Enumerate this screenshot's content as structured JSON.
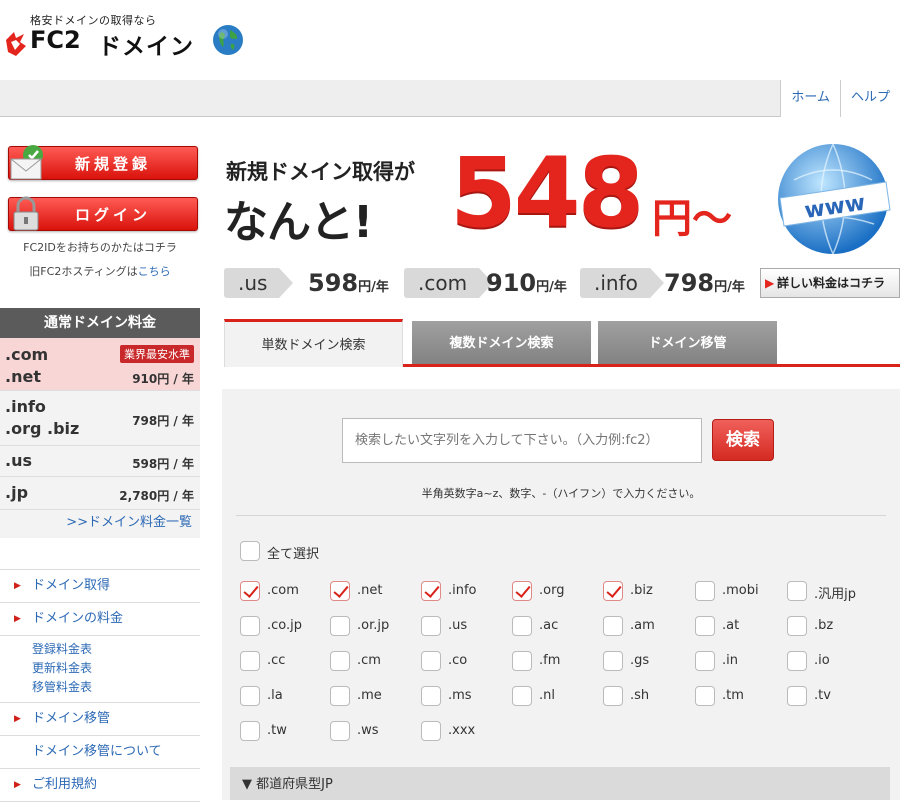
{
  "header": {
    "tagline": "格安ドメインの取得なら",
    "logo_fc2": "FC2",
    "logo_domain": "ドメイン",
    "nav": [
      "ホーム",
      "ヘルプ"
    ]
  },
  "sidebar": {
    "register_label": "新規登録",
    "login_label": "ログイン",
    "fc2id_note": "FC2IDをお持ちのかたはコチラ",
    "hosting_prefix": "旧FC2ホスティングは",
    "hosting_link": "こちら",
    "price_header": "通常ドメイン料金",
    "price_rows": [
      {
        "names": [
          ".com",
          ".net"
        ],
        "price": "910円 / 年",
        "badge": "業界最安水準"
      },
      {
        "names": [
          ".info",
          ".org .biz"
        ],
        "price": "798円 / 年"
      },
      {
        "names": [
          ".us"
        ],
        "price": "598円 / 年"
      },
      {
        "names": [
          ".jp"
        ],
        "price": "2,780円 / 年"
      }
    ],
    "price_list_link": ">>ドメイン料金一覧",
    "menu": {
      "acquire": "ドメイン取得",
      "pricing": "ドメインの料金",
      "pricing_sub": [
        "登録料金表",
        "更新料金表",
        "移管料金表"
      ],
      "transfer": "ドメイン移管",
      "transfer_about": "ドメイン移管について",
      "terms": "ご利用規約"
    }
  },
  "banner": {
    "line1": "新規ドメイン取得が",
    "line2": "なんと!",
    "price": "548",
    "unit": "円～",
    "tlds": [
      {
        "tld": ".us",
        "price": "598",
        "unit": "円/年"
      },
      {
        "tld": ".com",
        "price": "910",
        "unit": "円/年"
      },
      {
        "tld": ".info",
        "price": "798",
        "unit": "円/年"
      }
    ],
    "detail_label": "詳しい料金はコチラ"
  },
  "tabs": [
    "単数ドメイン検索",
    "複数ドメイン検索",
    "ドメイン移管"
  ],
  "search": {
    "placeholder": "検索したい文字列を入力して下さい。（入力例:fc2）",
    "button": "検索",
    "hint": "半角英数字a~z、数字、-（ハイフン）で入力ください。",
    "select_all": "全て選択",
    "tld_rows": [
      [
        {
          "l": ".com",
          "c": true
        },
        {
          "l": ".net",
          "c": true
        },
        {
          "l": ".info",
          "c": true
        },
        {
          "l": ".org",
          "c": true
        },
        {
          "l": ".biz",
          "c": true
        },
        {
          "l": ".mobi",
          "c": false
        },
        {
          "l": ".汎用jp",
          "c": false
        }
      ],
      [
        {
          "l": ".co.jp",
          "c": false
        },
        {
          "l": ".or.jp",
          "c": false
        },
        {
          "l": ".us",
          "c": false
        },
        {
          "l": ".ac",
          "c": false
        },
        {
          "l": ".am",
          "c": false
        },
        {
          "l": ".at",
          "c": false
        },
        {
          "l": ".bz",
          "c": false
        }
      ],
      [
        {
          "l": ".cc",
          "c": false
        },
        {
          "l": ".cm",
          "c": false
        },
        {
          "l": ".co",
          "c": false
        },
        {
          "l": ".fm",
          "c": false
        },
        {
          "l": ".gs",
          "c": false
        },
        {
          "l": ".in",
          "c": false
        },
        {
          "l": ".io",
          "c": false
        }
      ],
      [
        {
          "l": ".la",
          "c": false
        },
        {
          "l": ".me",
          "c": false
        },
        {
          "l": ".ms",
          "c": false
        },
        {
          "l": ".nl",
          "c": false
        },
        {
          "l": ".sh",
          "c": false
        },
        {
          "l": ".tm",
          "c": false
        },
        {
          "l": ".tv",
          "c": false
        }
      ],
      [
        {
          "l": ".tw",
          "c": false
        },
        {
          "l": ".ws",
          "c": false
        },
        {
          "l": ".xxx",
          "c": false
        }
      ]
    ],
    "prefecture_label": "▼ 都道府県型JP"
  },
  "colors": {
    "accent": "#d9221a",
    "link": "#2d6ab5"
  }
}
